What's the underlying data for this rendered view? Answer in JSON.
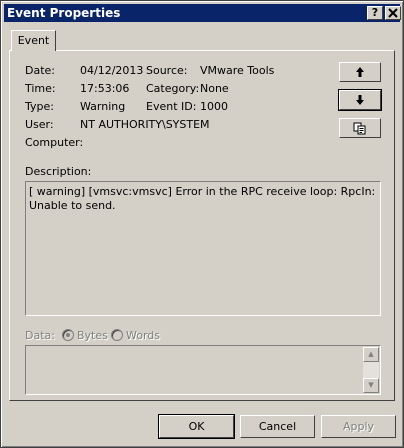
{
  "window": {
    "title": "Event Properties",
    "help_label": "?",
    "close_label": "✕"
  },
  "tabs": [
    {
      "label": "Event"
    }
  ],
  "fields": {
    "date_label": "Date:",
    "date_value": "04/12/2013",
    "source_label": "Source:",
    "source_value": "VMware Tools",
    "time_label": "Time:",
    "time_value": "17:53:06",
    "category_label": "Category:",
    "category_value": "None",
    "type_label": "Type:",
    "type_value": "Warning",
    "event_id_label": "Event ID:",
    "event_id_value": "1000",
    "user_label": "User:",
    "user_value": "NT AUTHORITY\\SYSTEM",
    "computer_label": "Computer:",
    "computer_value": ""
  },
  "nav": {
    "up_icon": "arrow-up-icon",
    "down_icon": "arrow-down-icon",
    "copy_icon": "copy-icon"
  },
  "description": {
    "label": "Description:",
    "text": "[ warning] [vmsvc:vmsvc] Error in the RPC receive loop: RpcIn: Unable to send."
  },
  "data": {
    "label": "Data:",
    "bytes_label": "Bytes",
    "words_label": "Words",
    "selected": "Bytes"
  },
  "buttons": {
    "ok": "OK",
    "cancel": "Cancel",
    "apply": "Apply"
  }
}
